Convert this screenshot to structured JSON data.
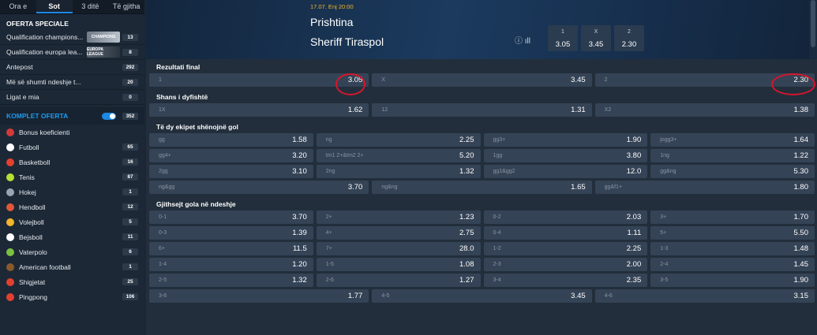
{
  "tabs": [
    "Ora e",
    "Sot",
    "3 ditë",
    "Të gjitha"
  ],
  "offers_title": "OFERTA SPECIALE",
  "specials": [
    {
      "label": "Qualification champions...",
      "count": "13"
    },
    {
      "label": "Qualification europa lea...",
      "count": "8"
    },
    {
      "label": "Antepost",
      "count": "292"
    },
    {
      "label": "Më së shumti ndeshje t...",
      "count": "20"
    },
    {
      "label": "Ligat e mia",
      "count": "0"
    }
  ],
  "banner_cl": "CHAMPIONS",
  "banner_el": "EUROPA LEAGUE",
  "komplet": {
    "label": "KOMPLET OFERTA",
    "count": "352"
  },
  "sports": [
    {
      "label": "Bonus koeficienti",
      "count": "",
      "color": "#d23a3a"
    },
    {
      "label": "Futboll",
      "count": "65",
      "color": "#ffffff"
    },
    {
      "label": "Basketboll",
      "count": "16",
      "color": "#e4402f"
    },
    {
      "label": "Tenis",
      "count": "87",
      "color": "#b8e034"
    },
    {
      "label": "Hokej",
      "count": "1",
      "color": "#9aa5b1"
    },
    {
      "label": "Hendboll",
      "count": "12",
      "color": "#e0573a"
    },
    {
      "label": "Volejboll",
      "count": "5",
      "color": "#f3b52a"
    },
    {
      "label": "Bejsboll",
      "count": "11",
      "color": "#ffffff"
    },
    {
      "label": "Vaterpolo",
      "count": "6",
      "color": "#7ac143"
    },
    {
      "label": "American football",
      "count": "1",
      "color": "#8a5a2b"
    },
    {
      "label": "Shigjetat",
      "count": "25",
      "color": "#e4402f"
    },
    {
      "label": "Pingpong",
      "count": "106",
      "color": "#e4402f"
    }
  ],
  "match": {
    "date": "17.07. Enj 20:00",
    "home": "Prishtina",
    "away": "Sheriff Tiraspol",
    "icons": "ⓘ ıll",
    "odds": [
      {
        "k": "1",
        "v": "3.05"
      },
      {
        "k": "X",
        "v": "3.45"
      },
      {
        "k": "2",
        "v": "2.30"
      }
    ]
  },
  "markets": [
    {
      "title": "Rezultati final",
      "rows": [
        [
          [
            "1",
            "3.05"
          ],
          [
            "X",
            "3.45"
          ],
          [
            "2",
            "2.30"
          ]
        ]
      ]
    },
    {
      "title": "Shans i dyfishtë",
      "rows": [
        [
          [
            "1X",
            "1.62"
          ],
          [
            "12",
            "1.31"
          ],
          [
            "X2",
            "1.38"
          ]
        ]
      ]
    },
    {
      "title": "Të dy ekipet shënojnë gol",
      "rows": [
        [
          [
            "gg",
            "1.58"
          ],
          [
            "ng",
            "2.25"
          ],
          [
            "gg3+",
            "1.90"
          ],
          [
            "jogg3+",
            "1.64"
          ]
        ],
        [
          [
            "gg4+",
            "3.20"
          ],
          [
            "tm1 2+&tm2 2+",
            "5.20"
          ],
          [
            "1gg",
            "3.80"
          ],
          [
            "1ng",
            "1.22"
          ]
        ],
        [
          [
            "2gg",
            "3.10"
          ],
          [
            "2ng",
            "1.32"
          ],
          [
            "gg1&gg2",
            "12.0"
          ],
          [
            "gg&ng",
            "5.30"
          ]
        ],
        [
          [
            "ng&gg",
            "3.70"
          ],
          [
            "ng&ng",
            "1.65"
          ],
          [
            "gg&f1+",
            "1.80"
          ]
        ]
      ]
    },
    {
      "title": "Gjithsejt gola në ndeshje",
      "rows": [
        [
          [
            "0-1",
            "3.70"
          ],
          [
            "2+",
            "1.23"
          ],
          [
            "0-2",
            "2.03"
          ],
          [
            "3+",
            "1.70"
          ]
        ],
        [
          [
            "0-3",
            "1.39"
          ],
          [
            "4+",
            "2.75"
          ],
          [
            "0-4",
            "1.11"
          ],
          [
            "5+",
            "5.50"
          ]
        ],
        [
          [
            "6+",
            "11.5"
          ],
          [
            "7+",
            "28.0"
          ],
          [
            "1-2",
            "2.25"
          ],
          [
            "1-3",
            "1.48"
          ]
        ],
        [
          [
            "1-4",
            "1.20"
          ],
          [
            "1-5",
            "1.08"
          ],
          [
            "2-3",
            "2.00"
          ],
          [
            "2-4",
            "1.45"
          ]
        ],
        [
          [
            "2-5",
            "1.32"
          ],
          [
            "2-6",
            "1.27"
          ],
          [
            "3-4",
            "2.35"
          ],
          [
            "3-5",
            "1.90"
          ]
        ],
        [
          [
            "3-6",
            "1.77"
          ],
          [
            "4-5",
            "3.45"
          ],
          [
            "4-6",
            "3.15"
          ]
        ]
      ]
    }
  ]
}
